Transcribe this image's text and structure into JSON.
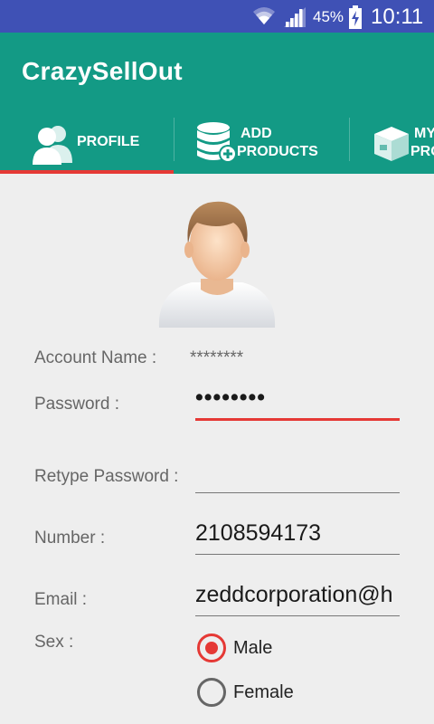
{
  "status_bar": {
    "battery": "45%",
    "time": "10:11"
  },
  "app": {
    "title": "CrazySellOut"
  },
  "tabs": [
    {
      "label_line1": "PROFILE",
      "label_line2": ""
    },
    {
      "label_line1": "ADD",
      "label_line2": "PRODUCTS"
    },
    {
      "label_line1": "MY",
      "label_line2": "PRO"
    }
  ],
  "form": {
    "account_name": {
      "label": "Account Name :",
      "value": "********"
    },
    "password": {
      "label": "Password :",
      "value": "••••••••"
    },
    "retype_password": {
      "label": "Retype Password :",
      "value": ""
    },
    "number": {
      "label": "Number :",
      "value": "2108594173"
    },
    "email": {
      "label": "Email :",
      "value": "zeddcorporation@h"
    },
    "sex": {
      "label": "Sex :",
      "options": [
        "Male",
        "Female"
      ],
      "selected": "Male"
    }
  },
  "colors": {
    "status_bar": "#3f51b5",
    "app_bar": "#139a85",
    "accent": "#e53935",
    "background": "#eeeeee"
  },
  "icons": {
    "status": [
      "wifi-icon",
      "signal-icon",
      "battery-charging-icon"
    ],
    "tabs": [
      "profile-users-icon",
      "add-database-icon",
      "product-box-icon"
    ],
    "avatar": "user-avatar"
  }
}
